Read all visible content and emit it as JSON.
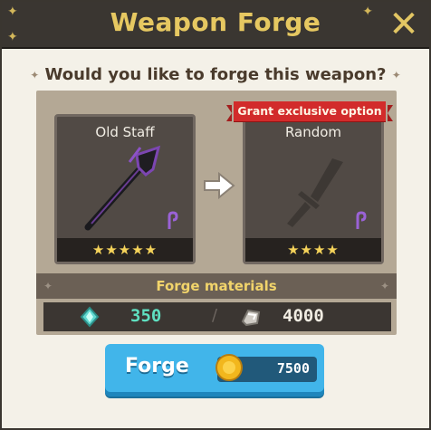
{
  "header": {
    "title": "Weapon Forge"
  },
  "question": "Would you like to forge this weapon?",
  "source": {
    "name": "Old Staff",
    "stars": "★★★★★"
  },
  "result": {
    "name": "Random",
    "stars": "★★★★",
    "ribbon": "Grant exclusive option"
  },
  "materials": {
    "title": "Forge materials",
    "crystal_amount": "350",
    "ore_amount": "4000"
  },
  "forge_button": {
    "label": "Forge",
    "price": "7500"
  },
  "colors": {
    "accent_gold": "#e6c861",
    "button_blue": "#41b5ea",
    "ribbon_red": "#d22b2b",
    "crystal_green": "#5fe0c0"
  }
}
